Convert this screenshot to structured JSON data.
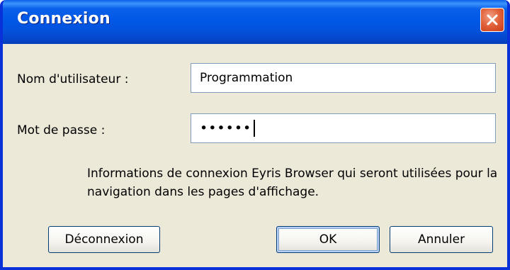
{
  "window": {
    "title": "Connexion",
    "close_icon": "close-icon"
  },
  "form": {
    "username_label": "Nom d'utilisateur :",
    "username_value": "Programmation",
    "password_label": "Mot de passe :",
    "password_value": "••••••"
  },
  "info_text": "Informations de connexion Eyris Browser qui seront utilisées pour la navigation dans les pages d'affichage.",
  "buttons": {
    "disconnect": "Déconnexion",
    "ok": "OK",
    "cancel": "Annuler"
  },
  "colors": {
    "titlebar": "#0058e6",
    "close_button": "#e2643c",
    "dialog_background": "#ece9d8"
  }
}
